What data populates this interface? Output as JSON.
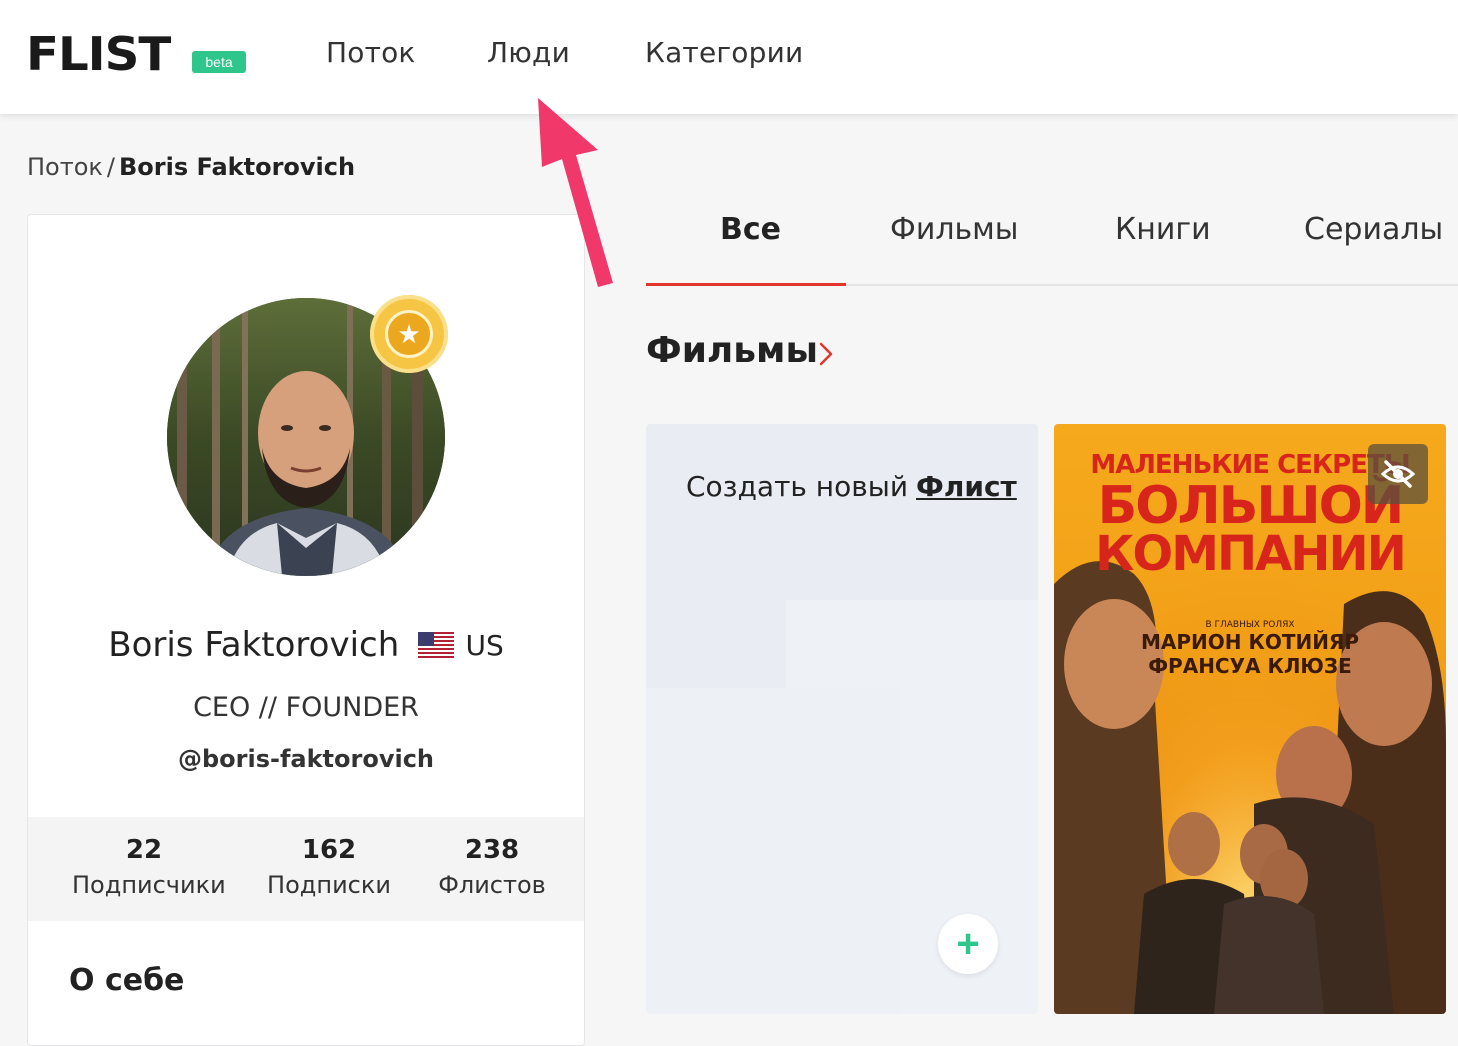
{
  "header": {
    "logo": "FLIST",
    "beta": "beta",
    "nav": [
      "Поток",
      "Люди",
      "Категории"
    ]
  },
  "breadcrumb": {
    "root": "Поток",
    "separator": "/",
    "current": "Boris Faktorovich"
  },
  "profile": {
    "name": "Boris Faktorovich",
    "country": "US",
    "title": "CEO // FOUNDER",
    "handle": "@boris-faktorovich",
    "stats": [
      {
        "value": "22",
        "label": "Подписчики"
      },
      {
        "value": "162",
        "label": "Подписки"
      },
      {
        "value": "238",
        "label": "Флистов"
      }
    ],
    "about_heading": "О себе"
  },
  "tabs": {
    "items": [
      "Все",
      "Фильмы",
      "Книги",
      "Сериалы"
    ],
    "active": "Все"
  },
  "section": {
    "title": "Фильмы"
  },
  "create_card": {
    "text": "Создать новый",
    "link": "Флист",
    "plus": "+"
  },
  "poster": {
    "line1": "МАЛЕНЬКИЕ СЕКРЕТЫ",
    "line2": "БОЛЬШОЙ",
    "line3": "КОМПАНИИ",
    "small": "В ГЛАВНЫХ РОЛЯХ",
    "cast1": "МАРИОН КОТИЙЯР",
    "cast2": "ФРАНСУА КЛЮЗЕ"
  },
  "colors": {
    "accent": "#e2362c",
    "brand_green": "#2ec68a",
    "badge_gold": "#f6c544"
  },
  "icons": [
    "star-badge-icon",
    "chevron-right-icon",
    "plus-icon",
    "eye-off-icon",
    "us-flag-icon",
    "pointer-arrow-icon"
  ]
}
